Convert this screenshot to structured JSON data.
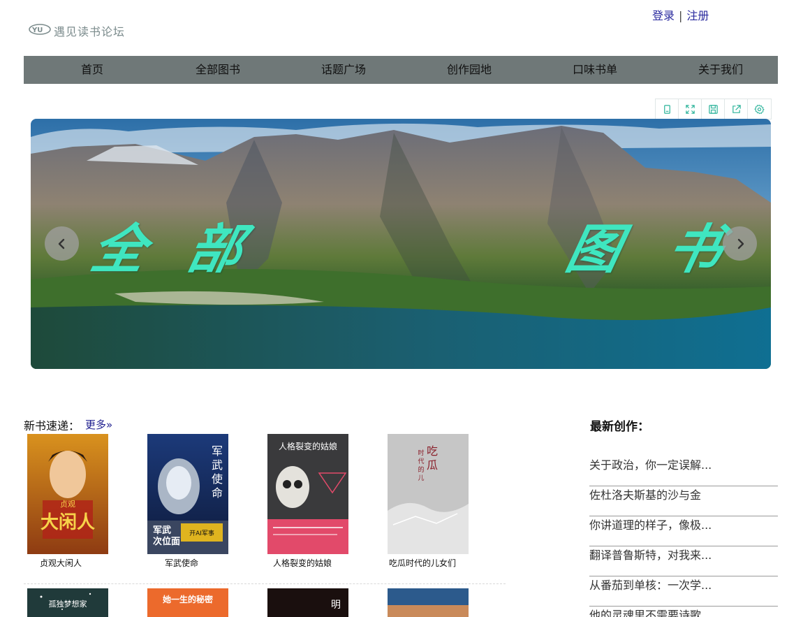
{
  "header": {
    "logo_text": "遇见读书论坛",
    "logo_mark": "YU",
    "login_label": "登录",
    "separator": "|",
    "register_label": "注册"
  },
  "nav": {
    "items": [
      "首页",
      "全部图书",
      "话题广场",
      "创作园地",
      "口味书单",
      "关于我们"
    ]
  },
  "banner": {
    "chars": [
      "全",
      "部",
      "图",
      "书"
    ]
  },
  "new_books": {
    "title": "新书速递：",
    "more_label": "更多»",
    "books": [
      {
        "title": "贞观大闲人",
        "cover_text": "贞观大闲人"
      },
      {
        "title": "军武使命",
        "cover_text": "军武使命"
      },
      {
        "title": "人格裂变的姑娘",
        "cover_text": "人格裂变的姑娘"
      },
      {
        "title": "吃瓜时代的儿女们",
        "cover_text": "吃瓜时代的儿女们"
      }
    ],
    "row2_covers": [
      {
        "cover_text": "孤独梦想家"
      },
      {
        "cover_text": "她一生的秘密"
      },
      {
        "cover_text": "明"
      },
      {
        "cover_text": ""
      }
    ]
  },
  "latest": {
    "title": "最新创作：",
    "items": [
      "关于政治，你一定误解...",
      "佐杜洛夫斯基的沙与金",
      "你讲道理的样子，像极...",
      "翻译普鲁斯特，对我来...",
      "从番茄到单核：一次学...",
      "他的灵魂里不需要诗歌"
    ]
  },
  "colors": {
    "nav_bg": "#6f7878",
    "link": "#2a2a9e",
    "banner_text": "#3fe6c0"
  }
}
